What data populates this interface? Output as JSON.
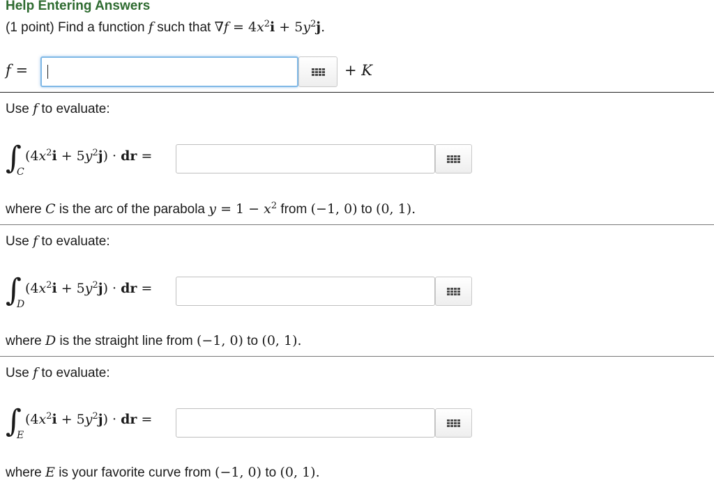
{
  "header": {
    "title": "Help Entering Answers"
  },
  "problem": {
    "points": "(1 point)",
    "prompt": "Find a function",
    "f": "f",
    "such_that": "such that",
    "nabla": "∇",
    "equals": "=",
    "coef_i": "4",
    "var_x": "x",
    "exp": "2",
    "vec_i": "i",
    "plus": "+",
    "coef_j": "5",
    "var_y": "y",
    "vec_j": "j",
    "period": "."
  },
  "f_answer": {
    "label_f": "f",
    "label_eq": "=",
    "value": "",
    "plus_K": "+ K"
  },
  "use_f": {
    "text": "Use",
    "f": "f",
    "rest": "to evaluate:"
  },
  "integral": {
    "open": "(4",
    "x": "x",
    "exp": "2",
    "i": "i",
    "plus5": " + 5",
    "y": "y",
    "j": "j",
    "close": ") · ",
    "dr": "dr",
    "eq": "="
  },
  "parts": [
    {
      "curve": "C",
      "answer": "",
      "where": "where",
      "desc": "is the arc of the parabola",
      "eq_y": "y",
      "eq_rest": "= 1 − ",
      "eq_x": "x",
      "eq_exp": "2",
      "from": "from",
      "start": "(−1, 0)",
      "to": "to",
      "end": "(0, 1)",
      "period": "."
    },
    {
      "curve": "D",
      "answer": "",
      "where": "where",
      "desc": "is the straight line from",
      "start": "(−1, 0)",
      "to": "to",
      "end": "(0, 1)",
      "period": "."
    },
    {
      "curve": "E",
      "answer": "",
      "where": "where",
      "desc": "is your favorite curve from",
      "start": "(−1, 0)",
      "to": "to",
      "end": "(0, 1)",
      "period": "."
    }
  ],
  "icons": {
    "keypad": "grid-keypad-icon"
  },
  "colors": {
    "header": "#2e6b30",
    "focus_border": "#7fb8e6"
  }
}
